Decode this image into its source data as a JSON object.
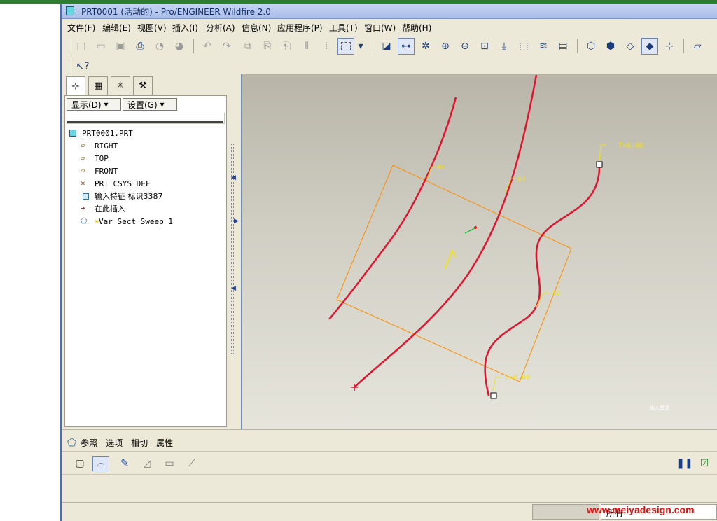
{
  "window": {
    "title": "PRT0001 (活动的) - Pro/ENGINEER Wildfire 2.0"
  },
  "menu": {
    "items": [
      "文件(F)",
      "编辑(E)",
      "视图(V)",
      "插入(I)",
      "分析(A)",
      "信息(N)",
      "应用程序(P)",
      "工具(T)",
      "窗口(W)",
      "帮助(H)"
    ]
  },
  "toolbar": {
    "icons": [
      "new-icon",
      "open-icon",
      "save-icon",
      "print-icon",
      "send-icon",
      "send2-icon",
      "undo-icon",
      "redo-icon",
      "copy-icon",
      "paste-icon",
      "paste-special-icon",
      "mirror-icon",
      "pattern-icon",
      "select-box-icon",
      "regenerate-icon",
      "datum-display-icon",
      "spin-center-icon",
      "zoom-in-icon",
      "zoom-out-icon",
      "refit-icon",
      "reorient-icon",
      "saved-views-icon",
      "layers-icon",
      "view-manager-icon",
      "wireframe-icon",
      "hidden-line-icon",
      "no-hidden-icon",
      "shading-icon",
      "model-tree-icon",
      "datum-plane-icon"
    ],
    "help_icon": "whats-this-icon"
  },
  "navigator": {
    "tabs": [
      "model-tree-tab",
      "folder-tab",
      "favorites-tab",
      "connections-tab"
    ],
    "show_button": "显示(D)",
    "settings_button": "设置(G)",
    "tree": [
      {
        "label": "PRT0001.PRT",
        "icon": "part-icon",
        "indent": 0
      },
      {
        "label": "RIGHT",
        "icon": "datum-plane-icon",
        "indent": 1
      },
      {
        "label": "TOP",
        "icon": "datum-plane-icon",
        "indent": 1
      },
      {
        "label": "FRONT",
        "icon": "datum-plane-icon",
        "indent": 1
      },
      {
        "label": "PRT_CSYS_DEF",
        "icon": "csys-icon",
        "indent": 1
      },
      {
        "label": "输入特征 标识3387",
        "icon": "import-feature-icon",
        "indent": 1
      },
      {
        "label": "在此插入",
        "icon": "insert-here-arrow-icon",
        "indent": 1
      },
      {
        "label": "Var Sect Sweep 1",
        "icon": "var-sect-sweep-icon",
        "indent": 1
      }
    ]
  },
  "viewport": {
    "labels": {
      "t_top": "T=0.00",
      "t_bottom": "T=0.00",
      "traj_1": "N1",
      "traj_2": "N4",
      "traj_3": "N2",
      "corner_text": "输入模式"
    },
    "colors": {
      "curve": "#e0142e",
      "plane": "#ff8c00",
      "annotation": "#f0e020"
    }
  },
  "dashboard": {
    "tabs": [
      "参照",
      "选项",
      "相切",
      "属性"
    ],
    "tools": [
      "solid-icon",
      "surface-icon",
      "sketch-icon",
      "remove-material-icon",
      "thicken-icon",
      "blend-icon"
    ],
    "pause_icon": "pause-icon",
    "preview_check": true
  },
  "status": {
    "filter_label": "所有"
  },
  "watermark": "www.meiyadesign.com"
}
